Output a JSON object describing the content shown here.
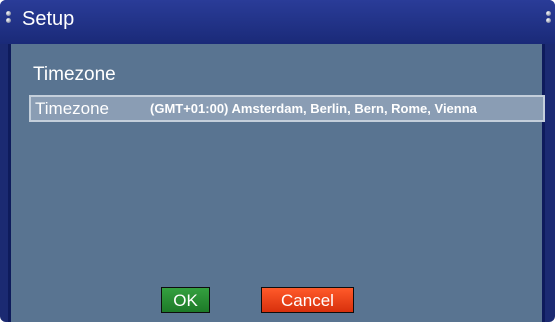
{
  "window": {
    "title": "Setup"
  },
  "panel": {
    "section_title": "Timezone",
    "setting": {
      "label": "Timezone",
      "value": "(GMT+01:00) Amsterdam, Berlin, Bern, Rome, Vienna"
    }
  },
  "buttons": {
    "ok_label": "OK",
    "cancel_label": "Cancel"
  },
  "colors": {
    "titlebar": "#1b2a72",
    "panel": "#597491",
    "selected_row": "#8a9db4",
    "ok_button": "#2a8a34",
    "cancel_button": "#f04a1c"
  }
}
